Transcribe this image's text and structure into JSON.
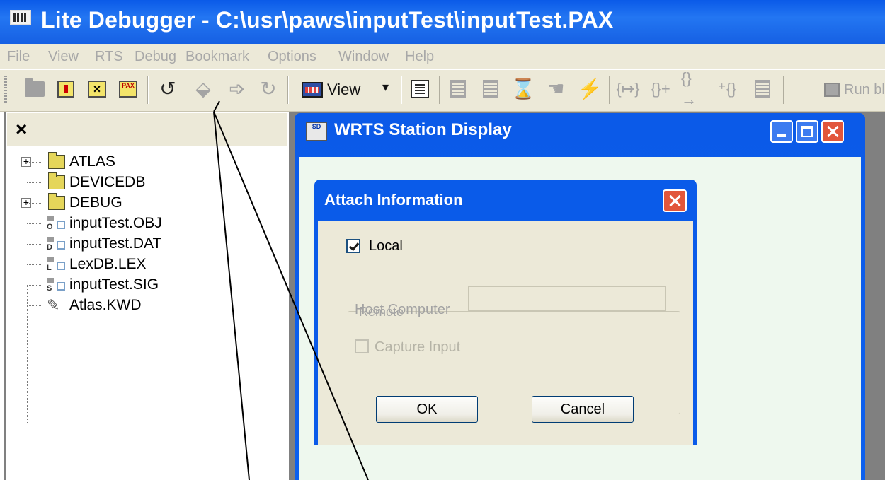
{
  "window": {
    "title": "Lite Debugger - C:\\usr\\paws\\inputTest\\inputTest.PAX"
  },
  "menu": [
    "File",
    "View",
    "RTS",
    "Debug",
    "Bookmark",
    "Options",
    "Window",
    "Help"
  ],
  "toolbar": {
    "view_label": "View",
    "view_arrow": "▾",
    "run_block_label": "Run block",
    "icons": [
      "open-folder-icon",
      "open-file-icon",
      "close-file-icon",
      "pax-icon",
      "attach-icon",
      "detach-icon",
      "step-icon",
      "reset-icon",
      "view-icon",
      "list-icon",
      "step-into-icon",
      "step-over-icon",
      "hourglass-icon",
      "hand-icon",
      "lightning-icon",
      "brace-icon-1",
      "brace-icon-2",
      "brace-icon-3",
      "brace-icon-4",
      "run-to-icon",
      "run-block-icon"
    ]
  },
  "tree_panel": {
    "close_glyph": "×",
    "items": [
      {
        "label": "ATLAS",
        "icon": "folder-icon",
        "expandable": true
      },
      {
        "label": "DEVICEDB",
        "icon": "folder-icon",
        "expandable": false
      },
      {
        "label": "DEBUG",
        "icon": "folder-icon",
        "expandable": true
      },
      {
        "label": "inputTest.OBJ",
        "icon": "object-file-icon",
        "letter": "O"
      },
      {
        "label": "inputTest.DAT",
        "icon": "data-file-icon",
        "letter": "D"
      },
      {
        "label": "LexDB.LEX",
        "icon": "lex-file-icon",
        "letter": "L"
      },
      {
        "label": "inputTest.SIG",
        "icon": "signal-file-icon",
        "letter": "S"
      },
      {
        "label": "Atlas.KWD",
        "icon": "keyword-file-icon"
      }
    ]
  },
  "child_window": {
    "title": "WRTS Station Display",
    "icon_text": "SD"
  },
  "dialog": {
    "title": "Attach Information",
    "local_label": "Local",
    "local_checked": true,
    "remote_group_label": "Remote",
    "host_computer_label": "Host Computer",
    "host_computer_value": "",
    "capture_input_label": "Capture Input",
    "capture_input_checked": false,
    "ok_label": "OK",
    "cancel_label": "Cancel"
  },
  "colors": {
    "titlebar": "#0a5ae8",
    "face": "#ece9d8",
    "close_red": "#e2563b",
    "client_bg": "#eef8ee"
  }
}
